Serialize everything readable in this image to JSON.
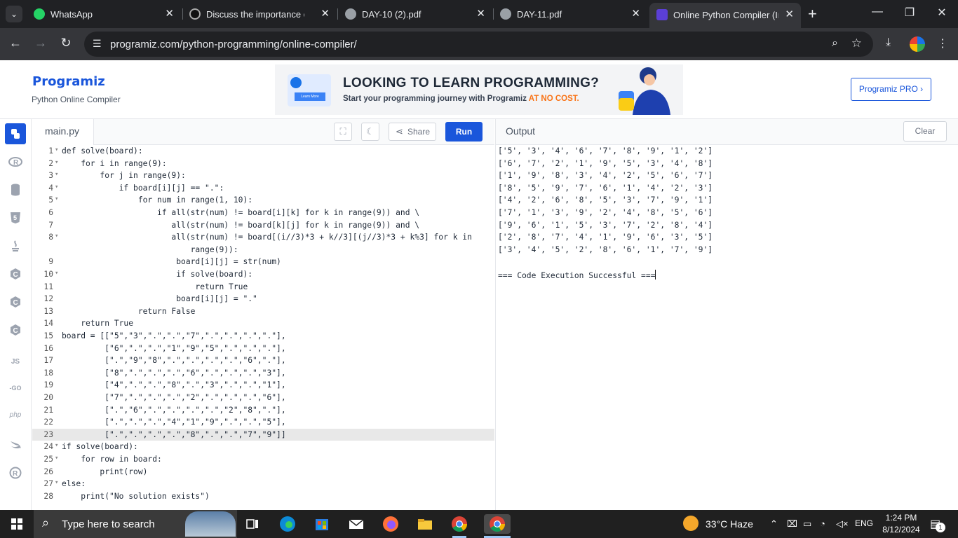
{
  "browser": {
    "tabs": [
      {
        "title": "WhatsApp",
        "icon": "whatsapp-icon"
      },
      {
        "title": "Discuss the importance of vi",
        "icon": "openai-icon"
      },
      {
        "title": "DAY-10 (2).pdf",
        "icon": "globe-icon"
      },
      {
        "title": "DAY-11.pdf",
        "icon": "globe-icon"
      },
      {
        "title": "Online Python Compiler (Inte",
        "icon": "programiz-icon",
        "active": true
      }
    ],
    "url": "programiz.com/python-programming/online-compiler/"
  },
  "site": {
    "logo": "Programiz",
    "subtitle": "Python Online Compiler",
    "banner_headline": "LOOKING TO LEARN PROGRAMMING?",
    "banner_sub_prefix": "Start your programming journey with Programiz ",
    "banner_sub_accent": "AT NO COST.",
    "banner_badge_text": "Learn More",
    "pro_button": "Programiz PRO ›"
  },
  "rail": {
    "js_label": "JS",
    "go_label": "-GO",
    "php_label": "php"
  },
  "editor": {
    "file_name": "main.py",
    "share_label": "Share",
    "run_label": "Run",
    "lines": [
      {
        "n": "1",
        "f": true,
        "t": "def solve(board):"
      },
      {
        "n": "2",
        "f": true,
        "t": "    for i in range(9):"
      },
      {
        "n": "3",
        "f": true,
        "t": "        for j in range(9):"
      },
      {
        "n": "4",
        "f": true,
        "t": "            if board[i][j] == \".\":"
      },
      {
        "n": "5",
        "f": true,
        "t": "                for num in range(1, 10):"
      },
      {
        "n": "6",
        "f": false,
        "t": "                    if all(str(num) != board[i][k] for k in range(9)) and \\"
      },
      {
        "n": "7",
        "f": false,
        "t": "                       all(str(num) != board[k][j] for k in range(9)) and \\"
      },
      {
        "n": "8",
        "f": true,
        "t": "                       all(str(num) != board[(i//3)*3 + k//3][(j//3)*3 + k%3] for k in"
      },
      {
        "n": "",
        "f": false,
        "t": "                           range(9)):"
      },
      {
        "n": "9",
        "f": false,
        "t": "                        board[i][j] = str(num)"
      },
      {
        "n": "10",
        "f": true,
        "t": "                        if solve(board):"
      },
      {
        "n": "11",
        "f": false,
        "t": "                            return True"
      },
      {
        "n": "12",
        "f": false,
        "t": "                        board[i][j] = \".\""
      },
      {
        "n": "13",
        "f": false,
        "t": "                return False"
      },
      {
        "n": "14",
        "f": false,
        "t": "    return True"
      },
      {
        "n": "15",
        "f": false,
        "t": "board = [[\"5\",\"3\",\".\",\".\",\"7\",\".\",\".\",\".\",\".\"],"
      },
      {
        "n": "16",
        "f": false,
        "t": "         [\"6\",\".\",\".\",\"1\",\"9\",\"5\",\".\",\".\",\".\"],"
      },
      {
        "n": "17",
        "f": false,
        "t": "         [\".\",\"9\",\"8\",\".\",\".\",\".\",\".\",\"6\",\".\"],"
      },
      {
        "n": "18",
        "f": false,
        "t": "         [\"8\",\".\",\".\",\".\",\"6\",\".\",\".\",\".\",\"3\"],"
      },
      {
        "n": "19",
        "f": false,
        "t": "         [\"4\",\".\",\".\",\"8\",\".\",\"3\",\".\",\".\",\"1\"],"
      },
      {
        "n": "20",
        "f": false,
        "t": "         [\"7\",\".\",\".\",\".\",\"2\",\".\",\".\",\".\",\"6\"],"
      },
      {
        "n": "21",
        "f": false,
        "t": "         [\".\",\"6\",\".\",\".\",\".\",\".\",\"2\",\"8\",\".\"],"
      },
      {
        "n": "22",
        "f": false,
        "t": "         [\".\",\".\",\".\",\"4\",\"1\",\"9\",\".\",\".\",\"5\"],"
      },
      {
        "n": "23",
        "f": false,
        "t": "         [\".\",\".\",\".\",\".\",\"8\",\".\",\".\",\"7\",\"9\"]]",
        "hl": true
      },
      {
        "n": "24",
        "f": true,
        "t": "if solve(board):"
      },
      {
        "n": "25",
        "f": true,
        "t": "    for row in board:"
      },
      {
        "n": "26",
        "f": false,
        "t": "        print(row)"
      },
      {
        "n": "27",
        "f": true,
        "t": "else:"
      },
      {
        "n": "28",
        "f": false,
        "t": "    print(\"No solution exists\")"
      }
    ]
  },
  "output": {
    "title": "Output",
    "clear_label": "Clear",
    "lines": [
      "['5', '3', '4', '6', '7', '8', '9', '1', '2']",
      "['6', '7', '2', '1', '9', '5', '3', '4', '8']",
      "['1', '9', '8', '3', '4', '2', '5', '6', '7']",
      "['8', '5', '9', '7', '6', '1', '4', '2', '3']",
      "['4', '2', '6', '8', '5', '3', '7', '9', '1']",
      "['7', '1', '3', '9', '2', '4', '8', '5', '6']",
      "['9', '6', '1', '5', '3', '7', '2', '8', '4']",
      "['2', '8', '7', '4', '1', '9', '6', '3', '5']",
      "['3', '4', '5', '2', '8', '6', '1', '7', '9']",
      "",
      "=== Code Execution Successful ==="
    ]
  },
  "taskbar": {
    "search_placeholder": "Type here to search",
    "weather": "33°C  Haze",
    "language": "ENG",
    "time": "1:24 PM",
    "date": "8/12/2024",
    "notification_count": "1"
  }
}
